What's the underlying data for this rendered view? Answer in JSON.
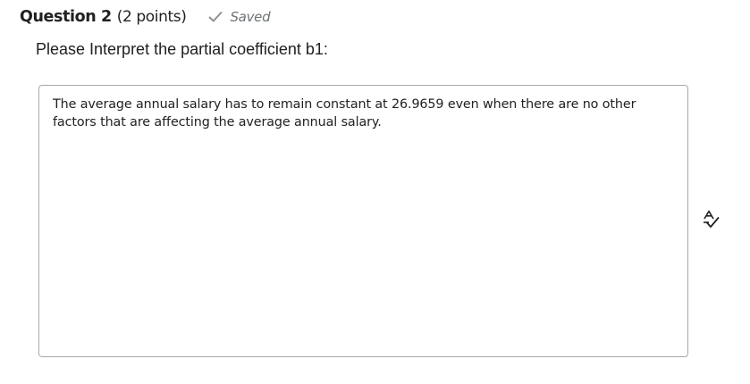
{
  "question": {
    "title": "Question 2",
    "points": "(2 points)",
    "status": "Saved",
    "prompt": "Please Interpret the partial coefficient b1:",
    "answer": "The average annual salary has to remain constant at 26.9659 even when there are no other factors that are affecting the average annual salary."
  },
  "icons": {
    "saved": "check-icon",
    "spellcheck": "spellcheck-icon"
  },
  "colors": {
    "text": "#202122",
    "status": "#6e7376",
    "border": "#a5a9ab"
  }
}
